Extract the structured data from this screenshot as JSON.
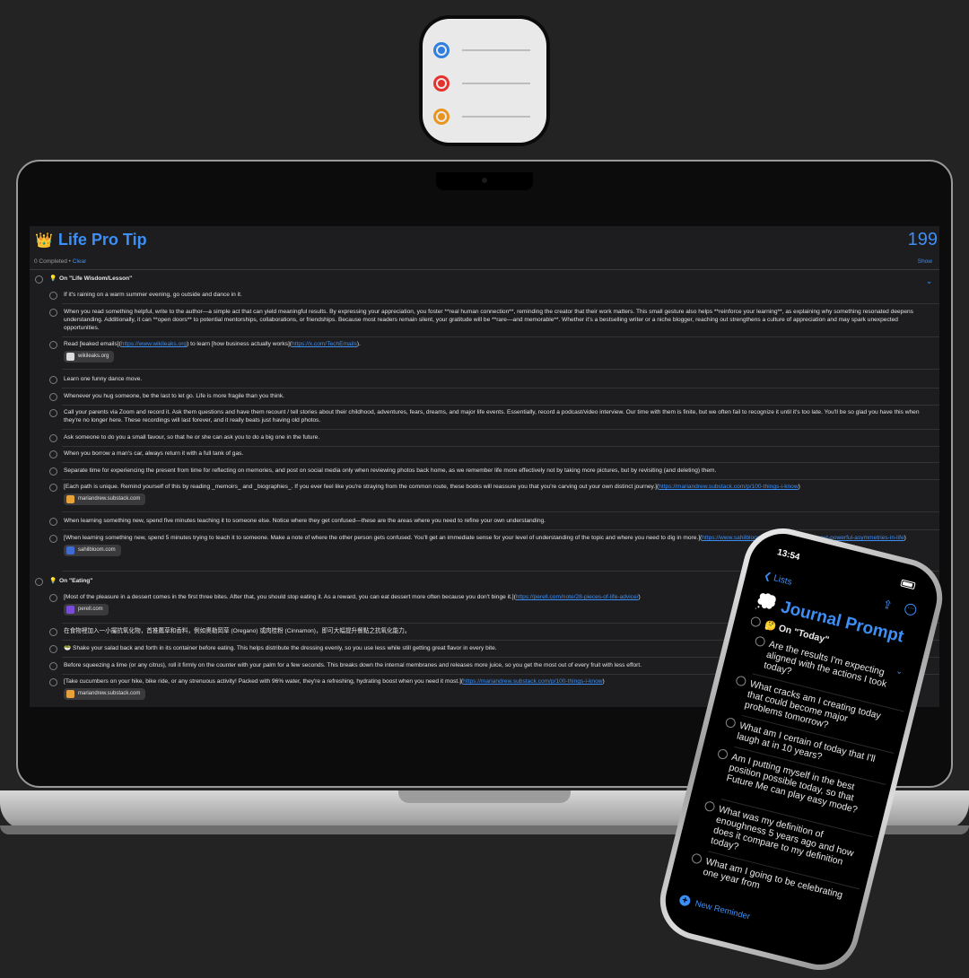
{
  "app_icon": {
    "dot_colors": [
      "#2f7fe0",
      "#e5322d",
      "#e8951f"
    ]
  },
  "mac": {
    "emoji": "👑",
    "title": "Life Pro Tip",
    "count": "199",
    "completed": "0 Completed",
    "bullet": "•",
    "clear": "Clear",
    "show": "Show",
    "sections": [
      {
        "id": "s1",
        "emoji": "💡",
        "label": "On \"Life Wisdom/Lesson\""
      },
      {
        "id": "s2",
        "emoji": "💡",
        "label": "On \"Eating\""
      }
    ],
    "items": [
      {
        "text": "If it's raining on a warm summer evening, go outside and dance in it."
      },
      {
        "text": "When you read something helpful, write to the author—a simple act that can yield meaningful results. By expressing your appreciation, you foster **real human connection**, reminding the creator that their work matters. This small gesture also helps **reinforce your learning**, as explaining why something resonated deepens understanding. Additionally, it can **open doors** to potential mentorships, collaborations, or friendships. Because most readers remain silent, your gratitude will be **rare—and memorable**. Whether it's a bestselling writer or a niche blogger, reaching out strengthens a culture of appreciation and may spark unexpected opportunities."
      },
      {
        "text_pre": "Read [leaked emails](",
        "link1": "https://www.wikileaks.org",
        "text_mid": ") to learn [how business actually works](",
        "link2": "https://x.com/TechEmails",
        "text_post": ").",
        "chip": "wikileaks.org"
      },
      {
        "text": "Learn one funny dance move."
      },
      {
        "text": "Whenever you hug someone, be the last to let go. Life is more fragile than you think."
      },
      {
        "text": "Call your parents via Zoom and record it. Ask them questions and have them recount / tell stories about their childhood, adventures, fears, dreams, and major life events. Essentially, record a podcast/video interview. Our time with them is finite, but we often fail to recognize it until it's too late. You'll be so glad you have this when they're no longer here. These recordings will last forever, and it really beats just having old photos."
      },
      {
        "text": "Ask someone to do you a small favour, so that he or she can ask you to do a big one in the future."
      },
      {
        "text": "When you borrow a man's car, always return it with a full tank of gas."
      },
      {
        "text": "Separate time for experiencing the present from time for reflecting on memories, and post on social media only when reviewing photos back home, as we remember life more effectively not by taking more pictures, but by revisiting (and deleting) them."
      },
      {
        "text_pre": "[Each path is unique. Remind yourself of this by reading _memoirs_ and _biographies_. If you ever feel like you're straying from the common route, these books will reassure you that you're carving out your own distinct journey.](",
        "link1": "https://mariandrew.substack.com/p/100-things-i-know",
        "text_post": ")",
        "chip": "mariandrew.substack.com"
      },
      {
        "text": "When learning something new, spend five minutes teaching it to someone else. Notice where they get confused—these are the areas where you need to refine your own understanding."
      },
      {
        "text_pre": "[When learning something new, spend 5 minutes trying to teach it to someone. Make a note of where the other person gets confused. You'll get an immediate sense for your level of understanding of the topic and where you need to dig in more.](",
        "link1": "https://www.sahilbloom.com/newsletter/the-most-powerful-asymmetries-in-life",
        "text_post": ")",
        "chip": "sahilbloom.com"
      },
      {
        "text_pre": "[Most of the pleasure in a dessert comes in the first three bites. After that, you should stop eating it. As a reward, you can eat dessert more often because you don't binge it.](",
        "link1": "https://perell.com/note/28-pieces-of-life-advice/",
        "text_post": ")",
        "chip": "perell.com"
      },
      {
        "text": "在食物裡加入一小撮抗氧化物，首推薦草和香料，例如奧勒岡草 (Oregano) 或肉桂粉 (Cinnamon)，即可大幅提升餐點之抗氧化能力。"
      },
      {
        "text": "🥗 Shake your salad back and forth in its container before eating. This helps distribute the dressing evenly, so you use less while still getting great flavor in every bite."
      },
      {
        "text": "Before squeezing a lime (or any citrus), roll it firmly on the counter with your palm for a few seconds. This breaks down the internal membranes and releases more juice, so you get the most out of every fruit with less effort."
      },
      {
        "text_pre": "[Take cucumbers on your hike, bike ride, or any strenuous activity! Packed with 96% water, they're a refreshing, hydrating boost when you need it most.](",
        "link1": "https://mariandrew.substack.com/p/100-things-i-know",
        "text_post": ")",
        "chip": "mariandrew.substack.com"
      }
    ]
  },
  "phone": {
    "time": "13:54",
    "back": "Lists",
    "emoji": "💭",
    "title": "Journal Prompt",
    "section": "🤔 On \"Today\"",
    "items": [
      "Are the results I'm expecting aligned with the actions I took today?",
      "What cracks am I creating today that could become major problems tomorrow?",
      "What am I certain of today that I'll laugh at in 10 years?",
      "Am I putting myself in the best position possible today, so that Future Me can play easy mode?",
      "What was my definition of enoughness 5 years ago and how does it compare to my definition today?",
      "What am I going to be celebrating one year from"
    ],
    "new_reminder": "New Reminder"
  }
}
